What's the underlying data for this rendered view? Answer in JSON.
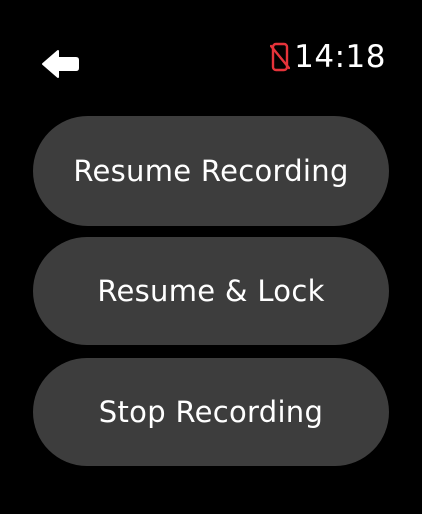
{
  "status": {
    "back_icon": "arrow-left-icon",
    "connection_icon": "iphone-disconnected-icon",
    "connection_icon_color": "#e5333a",
    "time": "14:18"
  },
  "menu": {
    "items": [
      {
        "label": "Resume Recording"
      },
      {
        "label": "Resume & Lock"
      },
      {
        "label": "Stop Recording"
      }
    ]
  },
  "colors": {
    "background": "#000000",
    "button": "#3d3d3d",
    "text": "#ffffff"
  }
}
